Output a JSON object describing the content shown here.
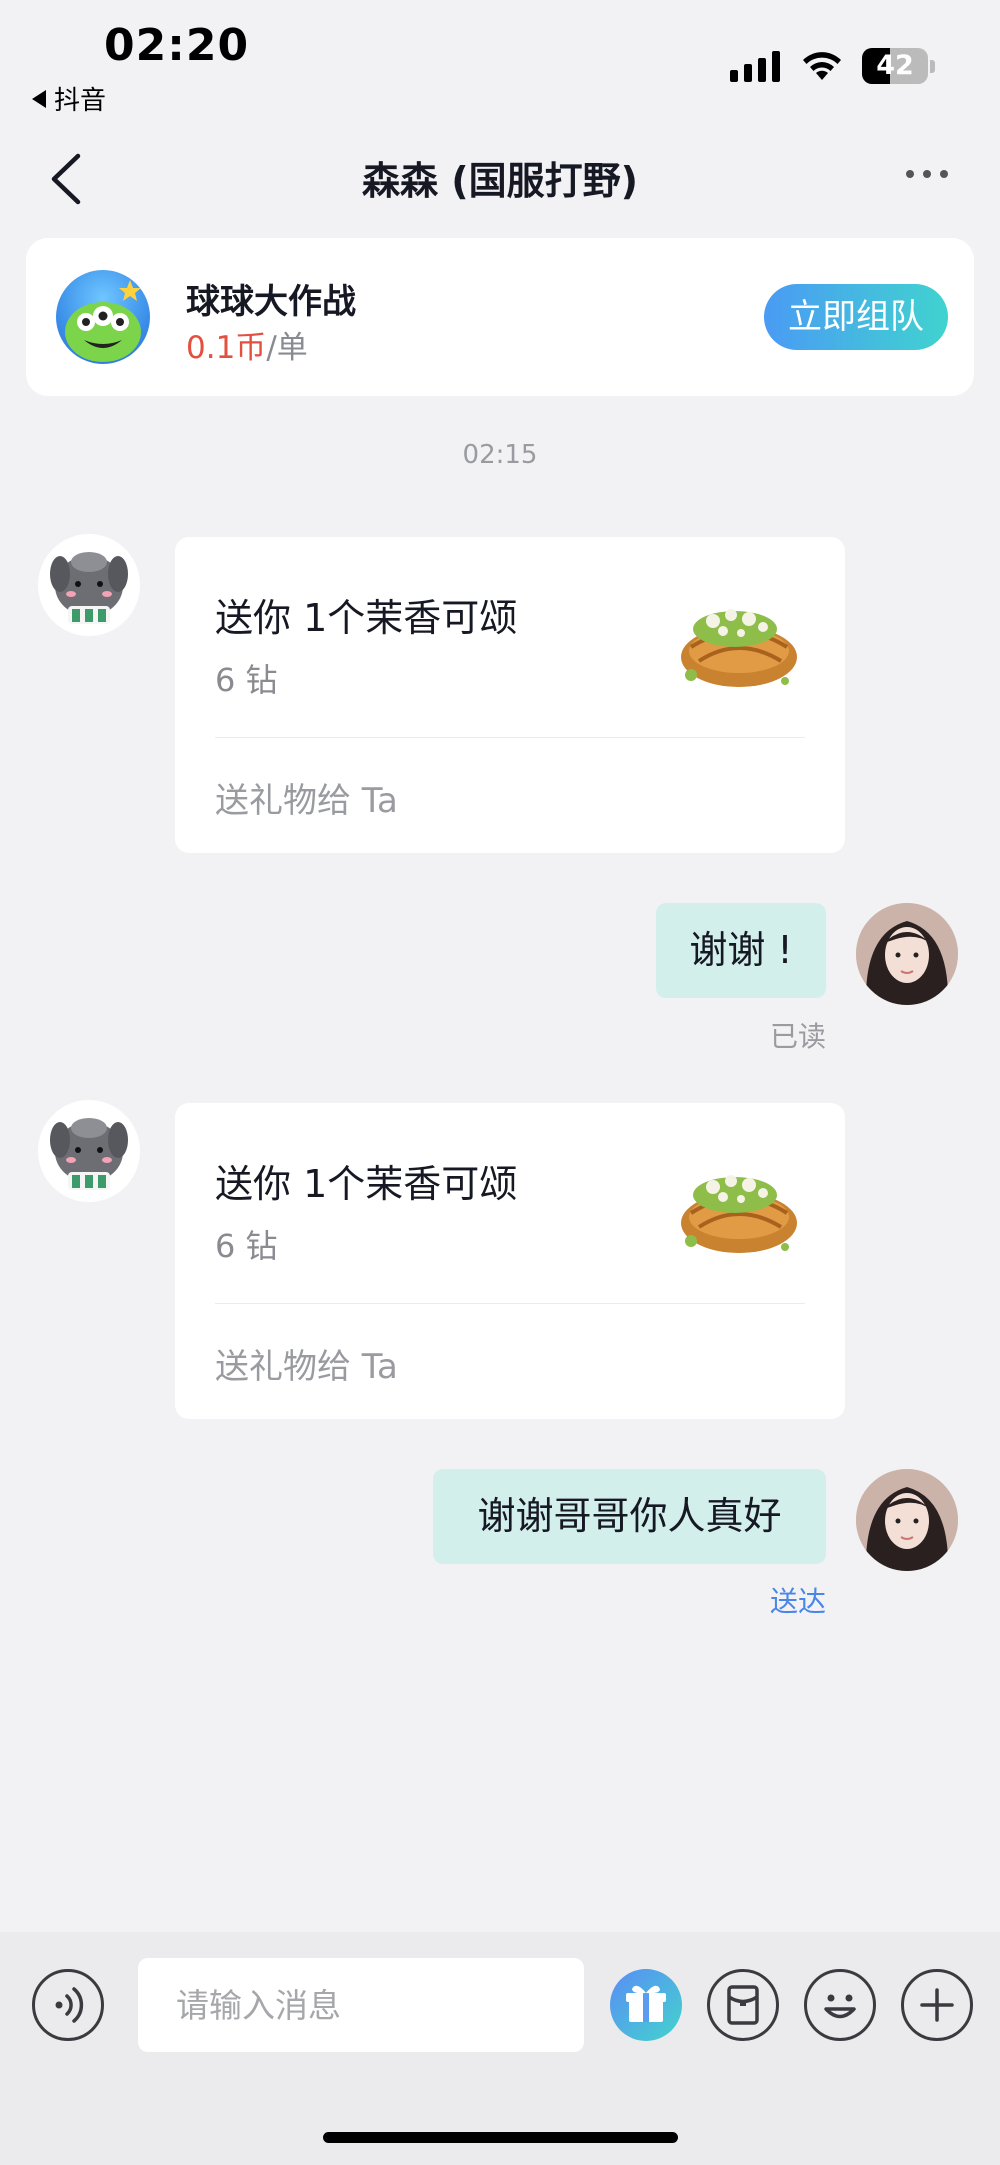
{
  "status_bar": {
    "time": "02:20",
    "back_app_label": "抖音",
    "battery": "42"
  },
  "nav": {
    "title": "森森 (国服打野)",
    "back_icon": "chevron-left-icon",
    "more_icon": "more-icon"
  },
  "game_card": {
    "title": "球球大作战",
    "price_value": "0.1币",
    "price_unit": "/单",
    "button_label": "立即组队",
    "icon": "alien-game-icon"
  },
  "chat": {
    "timestamp": "02:15",
    "messages": [
      {
        "type": "gift",
        "side": "left",
        "title": "送你 1个茉香可颂",
        "subtitle": "6 钻",
        "action": "送礼物给 Ta",
        "image": "croissant-gift-image"
      },
      {
        "type": "text",
        "side": "right",
        "text": "谢谢 !",
        "status": "已读"
      },
      {
        "type": "gift",
        "side": "left",
        "title": "送你 1个茉香可颂",
        "subtitle": "6 钻",
        "action": "送礼物给 Ta",
        "image": "croissant-gift-image"
      },
      {
        "type": "text",
        "side": "right",
        "text": "谢谢哥哥你人真好",
        "status": "送达"
      }
    ]
  },
  "input_bar": {
    "placeholder": "请输入消息",
    "voice_icon": "voice-icon",
    "gift_icon": "gift-icon",
    "red_packet_icon": "red-packet-icon",
    "emoji_icon": "emoji-icon",
    "add_icon": "plus-icon"
  },
  "colors": {
    "price_red": "#e4503f",
    "bubble_teal": "#d3efec",
    "read_gray": "#9a9ba0",
    "delivered_blue": "#4a86e8",
    "accent_gradient_start": "#4a9bf4",
    "accent_gradient_end": "#40d3cf"
  }
}
